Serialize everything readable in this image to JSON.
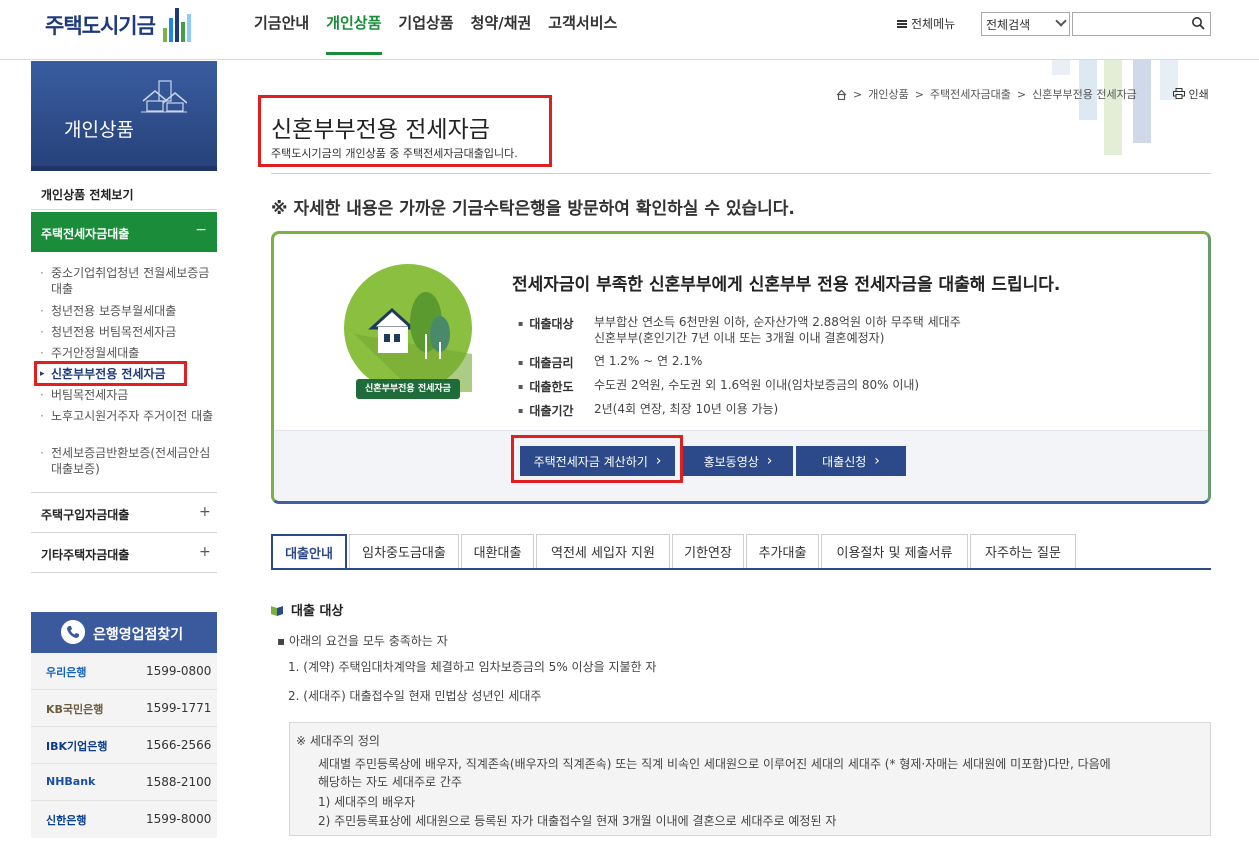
{
  "header": {
    "logo_text": "주택도시기금",
    "nav": [
      "기금안내",
      "개인상품",
      "기업상품",
      "청약/채권",
      "고객서비스"
    ],
    "all_menu": "전체메뉴",
    "search_scope": "전체검색",
    "search_placeholder": ""
  },
  "sidebar": {
    "title": "개인상품",
    "view_all": "개인상품 전체보기",
    "active_category": "주택전세자금대출",
    "active_toggle": "−",
    "sub_items": [
      "중소기업취업청년 전월세보증금대출",
      "청년전용 보증부월세대출",
      "청년전용 버팀목전세자금",
      "주거안정월세대출",
      "신혼부부전용 전세자금",
      "버팀목전세자금",
      "노후고시원거주자 주거이전 대출",
      "전세보증금반환보증(전세금안심대출보증)"
    ],
    "categories": [
      "주택구입자금대출",
      "기타주택자금대출"
    ],
    "plus": "+"
  },
  "bank": {
    "title": "은행영업점찾기",
    "rows": [
      {
        "name": "우리은행",
        "phone": "1599-0800",
        "color": "#1565c0"
      },
      {
        "name": "KB국민은행",
        "phone": "1599-1771",
        "color": "#6b5c3e"
      },
      {
        "name": "IBK기업은행",
        "phone": "1566-2566",
        "color": "#0d3c8c"
      },
      {
        "name": "NHBank",
        "phone": "1588-2100",
        "color": "#1b4fa0"
      },
      {
        "name": "신한은행",
        "phone": "1599-8000",
        "color": "#0b3d91"
      }
    ]
  },
  "breadcrumb": {
    "items": [
      "개인상품",
      "주택전세자금대출",
      "신혼부부전용 전세자금"
    ],
    "sep": ">",
    "print": "인쇄"
  },
  "page": {
    "title": "신혼부부전용 전세자금",
    "subtitle": "주택도시기금의 개인상품 중 주택전세자금대출입니다.",
    "notice": "※ 자세한 내용은 가까운 기금수탁은행을 방문하여 확인하실 수 있습니다."
  },
  "info": {
    "emblem_label": "신혼부부전용 전세자금",
    "headline": "전세자금이 부족한 신혼부부에게 신혼부부 전용 전세자금을 대출해 드립니다.",
    "rows": [
      {
        "label": "대출대상",
        "value1": "부부합산 연소득 6천만원 이하, 순자산가액 2.88억원 이하 무주택 세대주",
        "value2": "신혼부부(혼인기간 7년 이내 또는 3개월 이내 결혼예정자)"
      },
      {
        "label": "대출금리",
        "value1": "연 1.2% ~ 연 2.1%",
        "value2": ""
      },
      {
        "label": "대출한도",
        "value1": "수도권 2억원, 수도권 외 1.6억원 이내(임차보증금의 80% 이내)",
        "value2": ""
      },
      {
        "label": "대출기간",
        "value1": "2년(4회 연장, 최장 10년 이용 가능)",
        "value2": ""
      }
    ],
    "buttons": [
      "주택전세자금 계산하기",
      "홍보동영상",
      "대출신청"
    ]
  },
  "tabs": [
    "대출안내",
    "임차중도금대출",
    "대환대출",
    "역전세 세입자 지원",
    "기한연장",
    "추가대출",
    "이용절차 및 제출서류",
    "자주하는 질문"
  ],
  "section": {
    "title": "대출 대상",
    "bullet": "아래의 요건을 모두 충족하는 자",
    "items": [
      "1. (계약) 주택임대차계약을 체결하고 임차보증금의 5% 이상을 지불한 자",
      "2. (세대주) 대출접수일 현재 민법상 성년인 세대주"
    ],
    "definition": {
      "title": "※ 세대주의 정의",
      "line1": "세대별 주민등록상에 배우자, 직계존속(배우자의 직계존속) 또는 직계 비속인 세대원으로 이루어진 세대의 세대주 (* 형제·자매는 세대원에 미포함)다만, 다음에",
      "line2": "해당하는 자도 세대주로 간주",
      "line3": "1) 세대주의 배우자",
      "line4": "2) 주민등록표상에 세대원으로 등록된 자가 대출접수일 현재 3개월 이내에 결혼으로 세대주로 예정된 자"
    }
  },
  "colors": {
    "accent_green": "#1a8c3a",
    "navy": "#2c4a8a",
    "highlight": "#e02020"
  }
}
